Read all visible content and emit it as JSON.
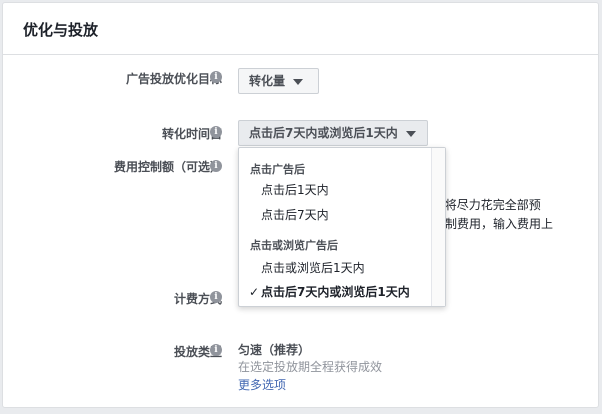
{
  "section": {
    "title": "优化与投放"
  },
  "fields": {
    "optimization_goal": {
      "label": "广告投放优化目标",
      "value": "转化量"
    },
    "conversion_window": {
      "label": "转化时间窗",
      "value": "点击后7天内或浏览后1天内"
    },
    "cost_control": {
      "label": "费用控制额（可选）"
    },
    "billing": {
      "label": "计费方式"
    },
    "delivery_type": {
      "label": "投放类型",
      "value": "匀速（推荐）",
      "description": "在选定投放期全程获得成效",
      "more_link": "更多选项"
    }
  },
  "background_text": {
    "line1": "k 将尽力花完全部预",
    "line2": "制费用，输入费用上"
  },
  "dropdown": {
    "groups": [
      {
        "header": "点击广告后",
        "items": [
          "点击后1天内",
          "点击后7天内"
        ]
      },
      {
        "header": "点击或浏览广告后",
        "items": [
          "点击或浏览后1天内",
          "点击后7天内或浏览后1天内"
        ]
      }
    ],
    "selected": "点击后7天内或浏览后1天内",
    "check_glyph": "✓"
  },
  "icons": {
    "info": "info-icon",
    "caret": "caret-down-icon",
    "check": "checkmark-icon"
  }
}
